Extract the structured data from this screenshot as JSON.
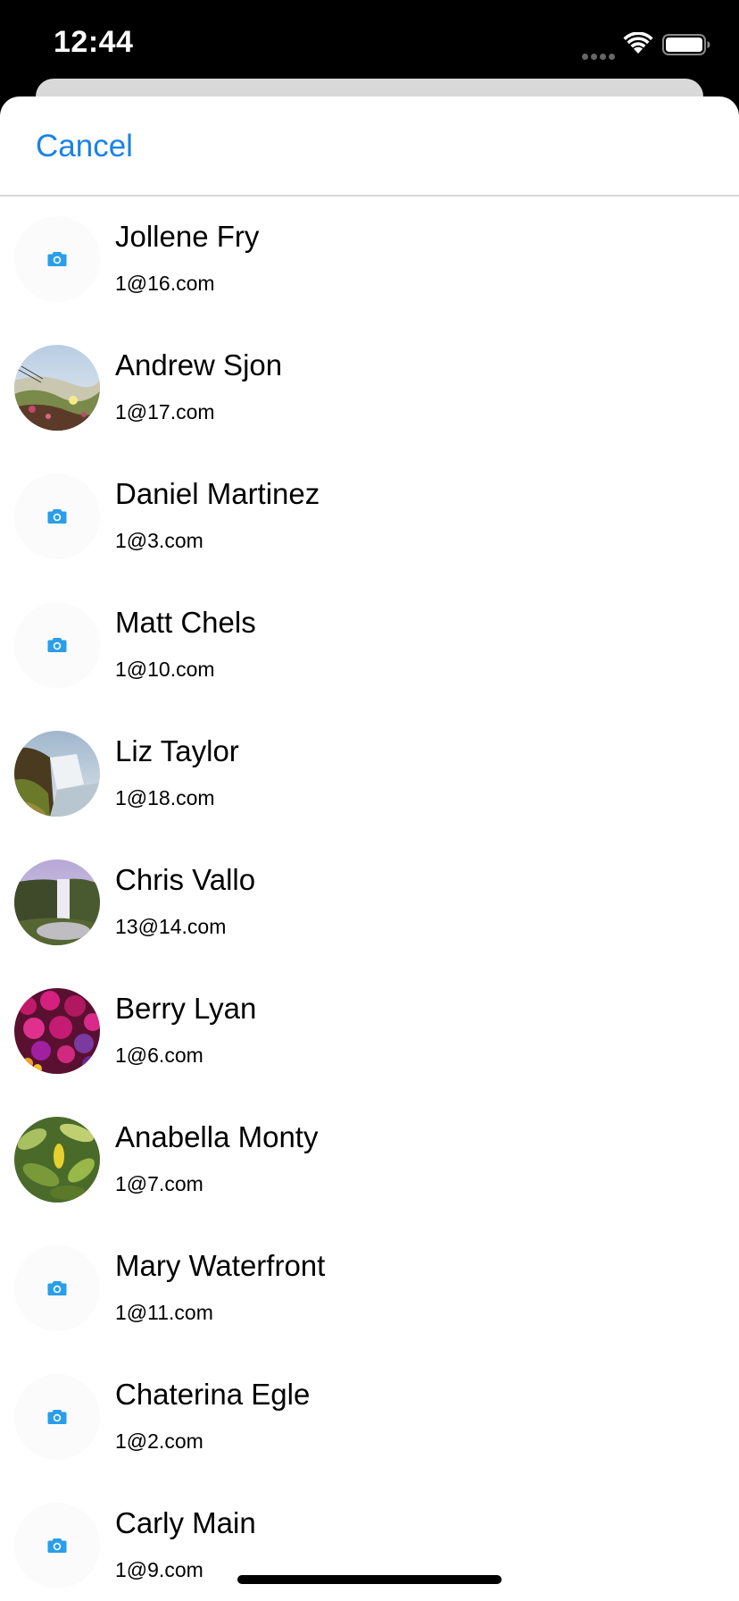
{
  "status_bar": {
    "time": "12:44"
  },
  "nav": {
    "cancel_label": "Cancel"
  },
  "colors": {
    "accent": "#1a82e8",
    "camera": "#2a9ee8"
  },
  "contacts": [
    {
      "name": "Jollene Fry",
      "email": "1@16.com",
      "avatar": "camera-placeholder"
    },
    {
      "name": "Andrew Sjon",
      "email": "1@17.com",
      "avatar": "photo-meadow"
    },
    {
      "name": "Daniel Martinez",
      "email": "1@3.com",
      "avatar": "camera-placeholder"
    },
    {
      "name": "Matt Chels",
      "email": "1@10.com",
      "avatar": "camera-placeholder"
    },
    {
      "name": "Liz Taylor",
      "email": "1@18.com",
      "avatar": "photo-waterfall-cliff"
    },
    {
      "name": "Chris Vallo",
      "email": "13@14.com",
      "avatar": "photo-waterfall-mist"
    },
    {
      "name": "Berry Lyan",
      "email": "1@6.com",
      "avatar": "photo-flowers"
    },
    {
      "name": "Anabella Monty",
      "email": "1@7.com",
      "avatar": "photo-leaves"
    },
    {
      "name": "Mary Waterfront",
      "email": "1@11.com",
      "avatar": "camera-placeholder"
    },
    {
      "name": "Chaterina Egle",
      "email": "1@2.com",
      "avatar": "camera-placeholder"
    },
    {
      "name": "Carly Main",
      "email": "1@9.com",
      "avatar": "camera-placeholder"
    }
  ]
}
